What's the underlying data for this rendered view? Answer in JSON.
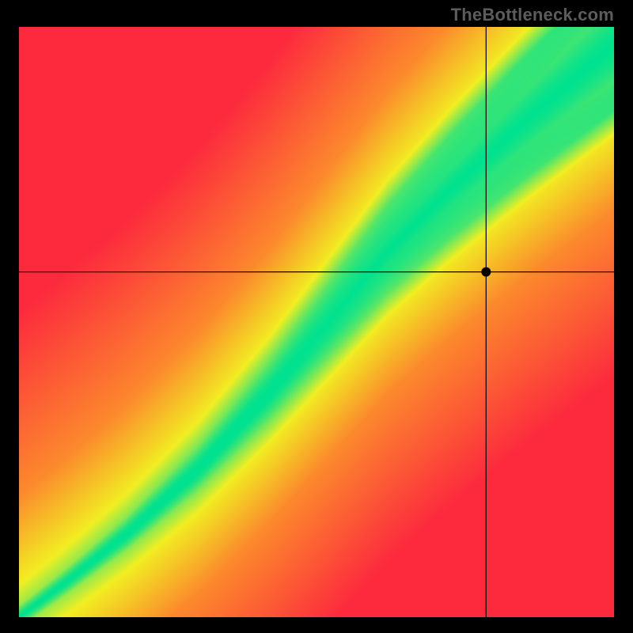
{
  "watermark": "TheBottleneck.com",
  "colors": {
    "red": "#fd2a3e",
    "orange": "#fc8a2d",
    "yellow": "#f2ef22",
    "green": "#00e290"
  },
  "chart_data": {
    "type": "heatmap",
    "title": "",
    "xlabel": "",
    "ylabel": "",
    "xlim": [
      0,
      100
    ],
    "ylim": [
      0,
      100
    ],
    "axes_visible": false,
    "description": "2D color field over CPU-vs-GPU score space. Green curved diagonal band marks balanced pairings (minimal bottleneck). Red regions in upper-left and lower-right indicate severe imbalance. Smooth orange/yellow gradient between.",
    "optimal_band": {
      "comment": "approximate centerline of the green band in (x%, y%) domain, with a slight S-curve bulge",
      "points": [
        [
          0,
          0
        ],
        [
          8,
          6
        ],
        [
          18,
          14
        ],
        [
          30,
          25
        ],
        [
          42,
          38
        ],
        [
          52,
          50
        ],
        [
          62,
          62
        ],
        [
          72,
          72
        ],
        [
          85,
          84
        ],
        [
          100,
          97
        ]
      ],
      "half_width_pct_low": 2,
      "half_width_pct_high": 12,
      "comment_width": "band is very thin near origin and ~12% wide near top-right"
    },
    "marker": {
      "x_pct": 78.5,
      "y_pct": 58.5
    },
    "crosshair": {
      "x_pct": 78.5,
      "y_pct": 58.5
    }
  }
}
